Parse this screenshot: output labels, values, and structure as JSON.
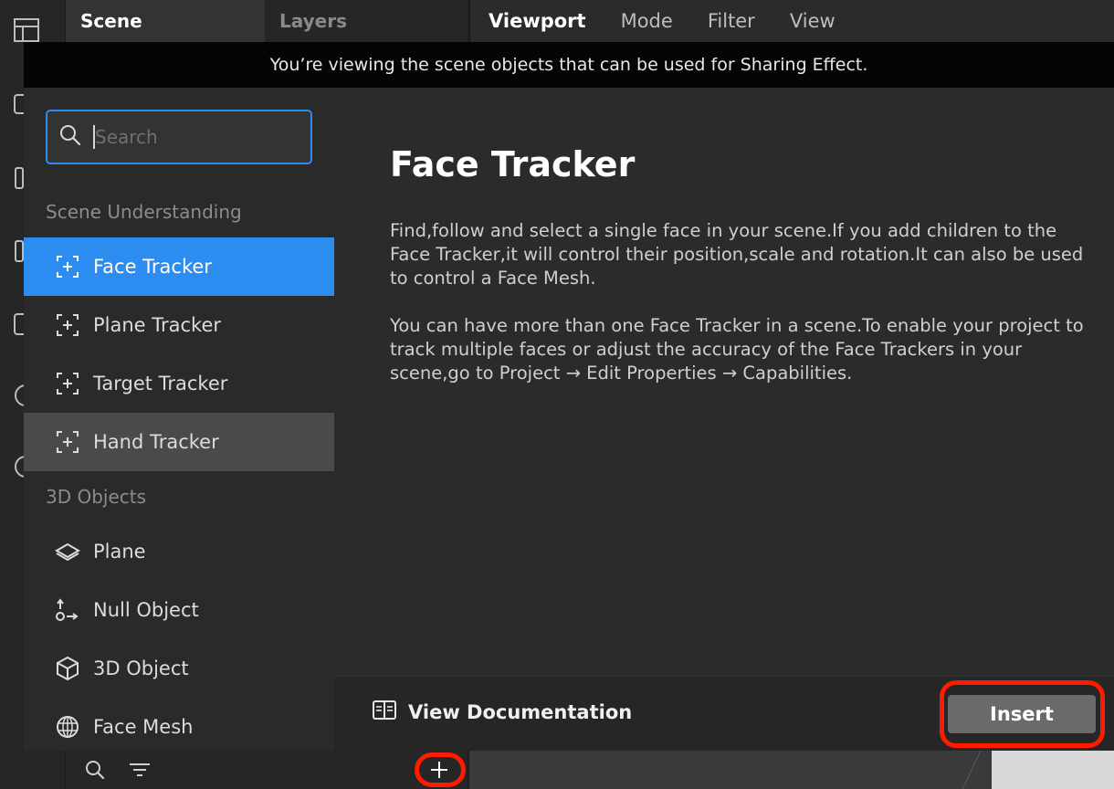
{
  "tabs": {
    "scene": "Scene",
    "layers": "Layers"
  },
  "viewport_menu": [
    "Viewport",
    "Mode",
    "Filter",
    "View"
  ],
  "banner": "You’re viewing the scene objects that can be used for Sharing Effect.",
  "search": {
    "placeholder": "Search",
    "value": ""
  },
  "sections": {
    "scene_understanding": "Scene Understanding",
    "objects_3d": "3D Objects"
  },
  "items": [
    {
      "label": "Face Tracker",
      "icon": "face-tracker-icon",
      "state": "selected"
    },
    {
      "label": "Plane Tracker",
      "icon": "plane-tracker-icon",
      "state": "normal"
    },
    {
      "label": "Target Tracker",
      "icon": "target-tracker-icon",
      "state": "normal"
    },
    {
      "label": "Hand Tracker",
      "icon": "hand-tracker-icon",
      "state": "hover"
    },
    {
      "label": "Plane",
      "icon": "plane-icon",
      "state": "normal"
    },
    {
      "label": "Null Object",
      "icon": "null-object-icon",
      "state": "normal"
    },
    {
      "label": "3D Object",
      "icon": "cube-icon",
      "state": "normal"
    },
    {
      "label": "Face Mesh",
      "icon": "face-mesh-icon",
      "state": "normal"
    }
  ],
  "detail": {
    "title": "Face Tracker",
    "paragraph1": "Find,follow and select a single face in your scene.If you add children to the Face Tracker,it will control their position,scale and rotation.It can also be used to control a Face Mesh.",
    "paragraph2": "You can have more than one Face Tracker in a scene.To enable your project to track multiple faces or adjust the accuracy of the Face Trackers in your scene,go to Project → Edit Properties → Capabilities."
  },
  "footer": {
    "doc_link": "View Documentation",
    "insert": "Insert"
  },
  "colors": {
    "accent": "#2d8cf0",
    "highlight": "#ff1a00"
  }
}
